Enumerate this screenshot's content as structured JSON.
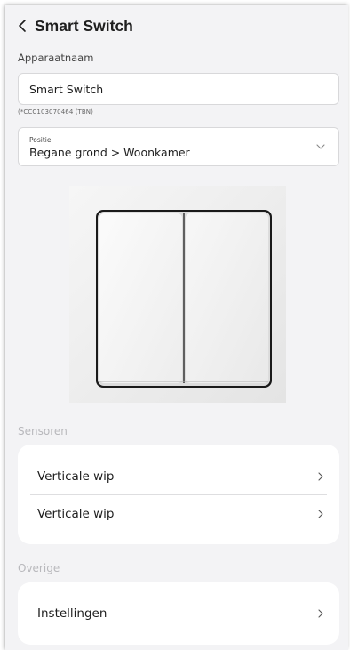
{
  "header": {
    "title": "Smart Switch",
    "back_icon": "chevron-left-icon"
  },
  "device": {
    "name_label": "Apparaatnaam",
    "name_value": "Smart Switch",
    "device_id": "(*CCC103070464 (TBN)"
  },
  "position": {
    "label": "Positie",
    "value": "Begane grond > Woonkamer",
    "chevron_icon": "chevron-down-icon"
  },
  "sensors": {
    "section_label": "Sensoren",
    "items": [
      {
        "label": "Verticale wip"
      },
      {
        "label": "Verticale wip"
      }
    ]
  },
  "other": {
    "section_label": "Overige",
    "items": [
      {
        "label": "Instellingen"
      }
    ]
  },
  "colors": {
    "background": "#f3f3f5",
    "card": "#ffffff",
    "muted_text": "#b8b8bc"
  }
}
